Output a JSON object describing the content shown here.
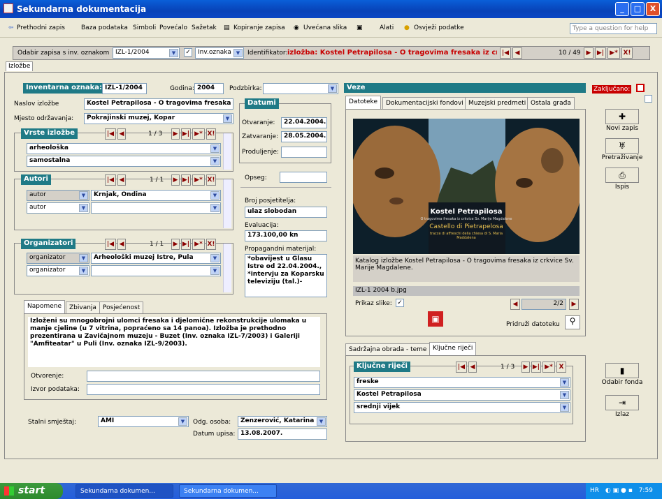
{
  "window": {
    "title": "Sekundarna dokumentacija",
    "btn_min": "_",
    "btn_max": "□",
    "btn_close": "X"
  },
  "menu": {
    "items": [
      "Prethodni zapis",
      "Baza podataka",
      "Simboli",
      "Povećalo",
      "Sažetak",
      "Kopiranje zapisa",
      "Uvećana slika",
      "Alati",
      "Osvježi podatke"
    ],
    "help_placeholder": "Type a question for help"
  },
  "navbar": {
    "odabir_label": "Odabir zapisa s inv. oznakom",
    "oznaka_value": "IZL-1/2004",
    "field_value": "Inv.oznaka",
    "identifikator_label": "Identifikator:",
    "identifikator_value": "izložba: Kostel Petrapilosa - O tragovima fresaka iz crkv",
    "counter": "10 / 49"
  },
  "main_tab": "Izložbe",
  "form": {
    "inv_label": "Inventarna oznaka:",
    "inv_value": "IZL-1/2004",
    "godina_label": "Godina:",
    "godina_value": "2004",
    "podzbirka_label": "Podzbirka:",
    "podzbirka_value": "",
    "naslov_label": "Naslov izložbe",
    "naslov_value": "Kostel Petrapilosa - O tragovima fresaka",
    "mjesto_label": "Mjesto održavanja:",
    "mjesto_value": "Pokrajinski muzej, Kopar",
    "vrste_hdr": "Vrste izložbe",
    "vrste_counter": "1 / 3",
    "vrste": [
      "arheološka",
      "samostalna"
    ],
    "autori_hdr": "Autori",
    "autori_counter": "1 / 1",
    "autori_role": [
      "autor",
      "autor"
    ],
    "autori_name": [
      "Krnjak, Ondina",
      ""
    ],
    "org_hdr": "Organizatori",
    "org_counter": "1 / 1",
    "org_role": [
      "organizator",
      "organizator"
    ],
    "org_name": [
      "Arheološki muzej Istre, Pula",
      ""
    ],
    "datumi_hdr": "Datumi",
    "otvaranje_label": "Otvaranje:",
    "otvaranje_value": "22.04.2004.",
    "zatvaranje_label": "Zatvaranje:",
    "zatvaranje_value": "28.05.2004.",
    "produljenje_label": "Produljenje:",
    "produljenje_value": "",
    "opseg_label": "Opseg:",
    "opseg_value": "",
    "broj_label": "Broj posjetitelja:",
    "broj_value": "ulaz slobodan",
    "evaluacija_label": "Evaluacija:",
    "evaluacija_value": "173.100,00 kn",
    "propag_label": "Propagandni materijal:",
    "propag_value": "*obavijest u Glasu Istre od 22.04.2004., *intervju za Koparsku televiziju (tal.)-",
    "tabs": [
      "Napomene",
      "Zbivanja",
      "Posjećenost"
    ],
    "napomene": "Izloženi su mnogobrojni ulomci fresaka i djelomične rekonstrukcije ulomaka u manje cjeline (u 7 vitrina, popraćeno sa 14 panoa). Izložba je prethodno prezentirana u Zavičajnom muzeju - Buzet (Inv. oznaka IZL-7/2003) i Galeriji \"Amfiteatar\" u Puli (Inv. oznaka IZL-9/2003).",
    "otvorenje_label": "Otvorenje:",
    "izvor_label": "Izvor podataka:",
    "smjestaj_label": "Stalni smještaj:",
    "smjestaj_value": "AMI",
    "odg_label": "Odg. osoba:",
    "odg_value": "Zenzerović, Katarina",
    "datum_label": "Datum upisa:",
    "datum_value": "13.08.2007."
  },
  "veze": {
    "hdr": "Veze",
    "tabs": [
      "Datoteke",
      "Dokumentacijski fondovi",
      "Muzejski predmeti",
      "Ostala građa"
    ],
    "caption": "Katalog izložbe Kostel Petrapilosa - O tragovima fresaka iz crkvice Sv. Marije Magdalene.",
    "filename": "IZL-1 2004 b.jpg",
    "prikaz_label": "Prikaz slike:",
    "img_counter": "2/2",
    "pridruzi_label": "Pridruži datoteku",
    "poster_title": "Kostel Petrapilosa",
    "poster_sub1": "O tragovima fresaka iz crkvice Sv. Marije Magdalene",
    "poster_title2": "Castello di Pietrapelosa",
    "poster_sub2": "tracce di affreschi della chiesa di S. Maria Maddalena"
  },
  "kljucne": {
    "tabs": [
      "Sadržajna obrada - teme",
      "Ključne riječi"
    ],
    "hdr": "Ključne riječi",
    "counter": "1 / 3",
    "items": [
      "freske",
      "Kostel Petrapilosa",
      "srednji vijek"
    ]
  },
  "right": {
    "zakljucano": "Zaključano:",
    "novi": "Novi zapis",
    "pretrazivanje": "Pretraživanje",
    "ispis": "Ispis",
    "fond": "Odabir fonda",
    "izlaz": "Izlaz"
  },
  "taskbar": {
    "start": "start",
    "items": [
      "Sekundarna dokumen...",
      "Sekundarna dokumen..."
    ],
    "lang": "HR",
    "time": "7:59"
  },
  "colors": {
    "teal": "#1f7a86",
    "red_text": "#c80000",
    "title_blue": "#0a46c4"
  }
}
